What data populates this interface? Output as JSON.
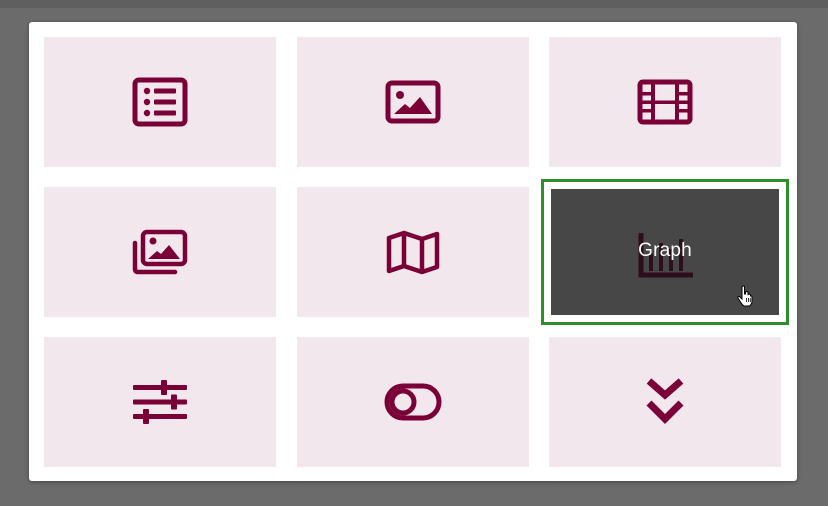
{
  "colors": {
    "backdrop": "#6b6b6b",
    "panel": "#ffffff",
    "tile_bg": "#f2e7ec",
    "icon": "#7a0038",
    "active_bg": "#474747",
    "active_outline": "#2e8f2a"
  },
  "tiles": [
    {
      "icon": "list-icon",
      "label": ""
    },
    {
      "icon": "image-icon",
      "label": ""
    },
    {
      "icon": "film-icon",
      "label": ""
    },
    {
      "icon": "gallery-icon",
      "label": ""
    },
    {
      "icon": "map-icon",
      "label": ""
    },
    {
      "icon": "graph-icon",
      "label": "Graph",
      "active": true
    },
    {
      "icon": "sliders-icon",
      "label": ""
    },
    {
      "icon": "toggle-icon",
      "label": ""
    },
    {
      "icon": "double-chevron-down-icon",
      "label": ""
    }
  ]
}
